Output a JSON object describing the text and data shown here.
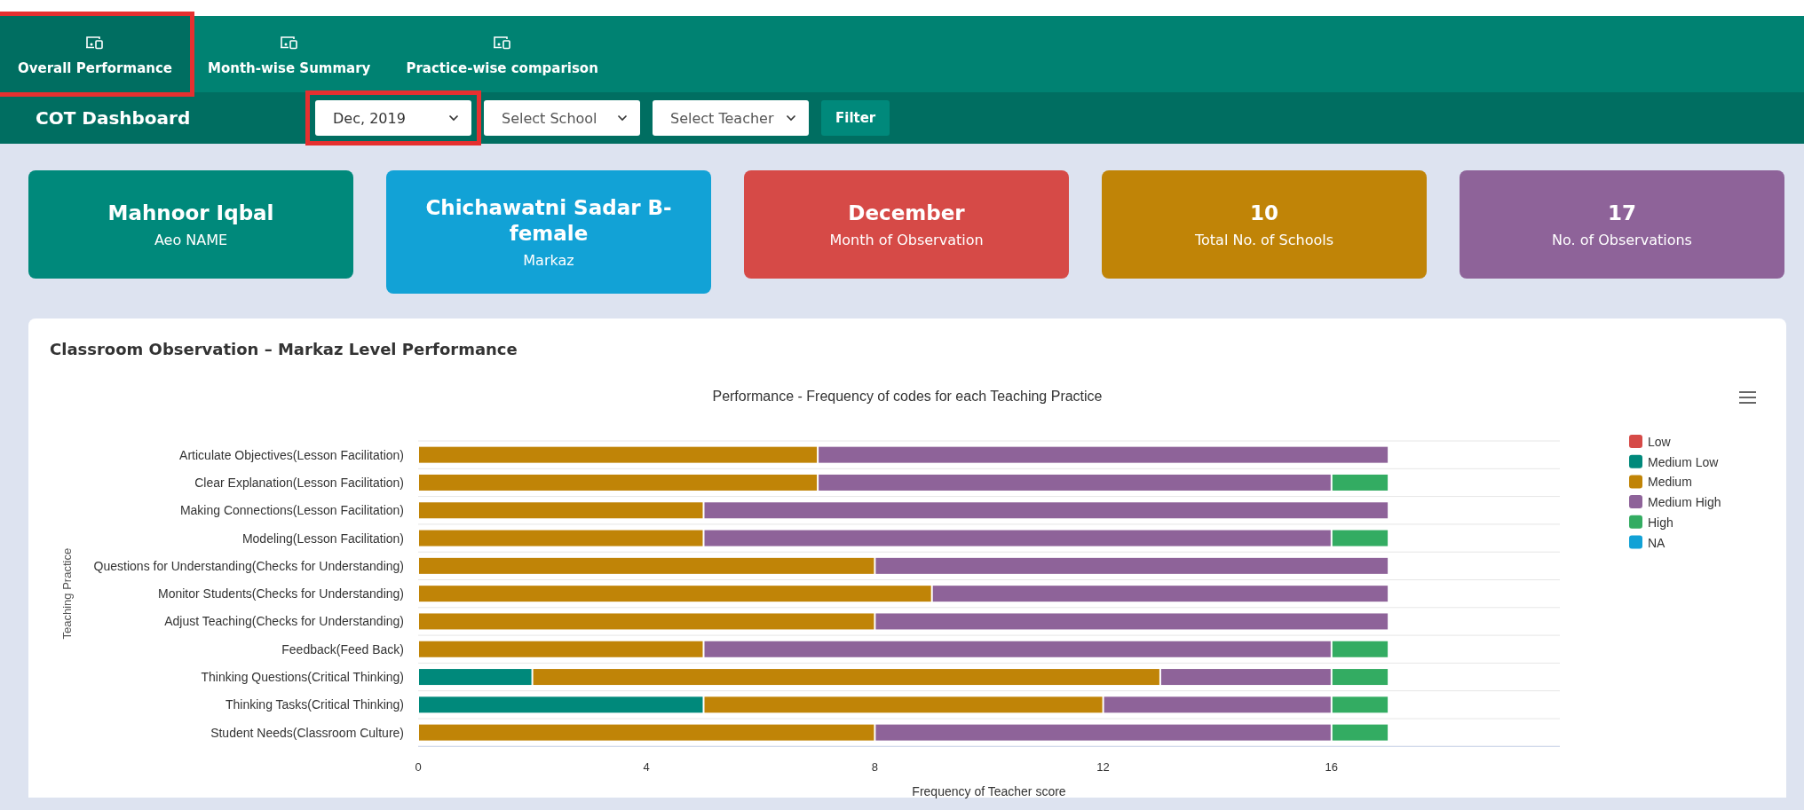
{
  "tabs": [
    {
      "label": "Overall Performance",
      "selected": true,
      "highlighted": true
    },
    {
      "label": "Month-wise Summary",
      "selected": false,
      "highlighted": false
    },
    {
      "label": "Practice-wise comparison",
      "selected": false,
      "highlighted": false
    }
  ],
  "toolbar": {
    "title": "COT Dashboard",
    "filters": [
      {
        "value": "Dec, 2019",
        "highlighted": true
      },
      {
        "placeholder": "Select School",
        "highlighted": false
      },
      {
        "placeholder": "Select Teacher",
        "highlighted": false
      }
    ],
    "button": "Filter"
  },
  "cards": [
    {
      "value": "Mahnoor Iqbal",
      "label": "Aeo NAME",
      "color": "#00897b"
    },
    {
      "value": "Chichawatni Sadar B-female",
      "label": "Markaz",
      "color": "#12a2d6"
    },
    {
      "value": "December",
      "label": "Month of Observation",
      "color": "#d64a47"
    },
    {
      "value": "10",
      "label": "Total No. of Schools",
      "color": "#c08407"
    },
    {
      "value": "17",
      "label": "No. of Observations",
      "color": "#8e6399"
    }
  ],
  "panel": {
    "title": "Classroom Observation – Markaz Level Performance",
    "chart_data": {
      "type": "bar",
      "orientation": "horizontal",
      "stacked": true,
      "title": "Performance - Frequency of codes for each Teaching Practice",
      "xlabel": "Frequency of Teacher score",
      "ylabel": "Teaching Practice",
      "categories": [
        "Articulate Objectives(Lesson Facilitation)",
        "Clear Explanation(Lesson Facilitation)",
        "Making Connections(Lesson Facilitation)",
        "Modeling(Lesson Facilitation)",
        "Questions for Understanding(Checks for Understanding)",
        "Monitor Students(Checks for Understanding)",
        "Adjust Teaching(Checks for Understanding)",
        "Feedback(Feed Back)",
        "Thinking Questions(Critical Thinking)",
        "Thinking Tasks(Critical Thinking)",
        "Student Needs(Classroom Culture)"
      ],
      "series": [
        {
          "name": "Low",
          "color": "#d64a47",
          "values": [
            0,
            0,
            0,
            0,
            0,
            0,
            0,
            0,
            0,
            0,
            0
          ]
        },
        {
          "name": "Medium Low",
          "color": "#00897b",
          "values": [
            0,
            0,
            0,
            0,
            0,
            0,
            0,
            0,
            2,
            5,
            0
          ]
        },
        {
          "name": "Medium",
          "color": "#c08407",
          "values": [
            7,
            7,
            5,
            5,
            8,
            9,
            8,
            5,
            11,
            7,
            8
          ]
        },
        {
          "name": "Medium High",
          "color": "#8e6399",
          "values": [
            10,
            9,
            12,
            11,
            9,
            8,
            9,
            11,
            3,
            4,
            8
          ]
        },
        {
          "name": "High",
          "color": "#33ac62",
          "values": [
            0,
            1,
            0,
            1,
            0,
            0,
            0,
            1,
            1,
            1,
            1
          ]
        },
        {
          "name": "NA",
          "color": "#12a2d6",
          "values": [
            0,
            0,
            0,
            0,
            0,
            0,
            0,
            0,
            0,
            0,
            0
          ]
        }
      ],
      "xlim": [
        0,
        20
      ],
      "xticks": [
        0,
        4,
        8,
        12,
        16
      ],
      "legend": true
    }
  }
}
